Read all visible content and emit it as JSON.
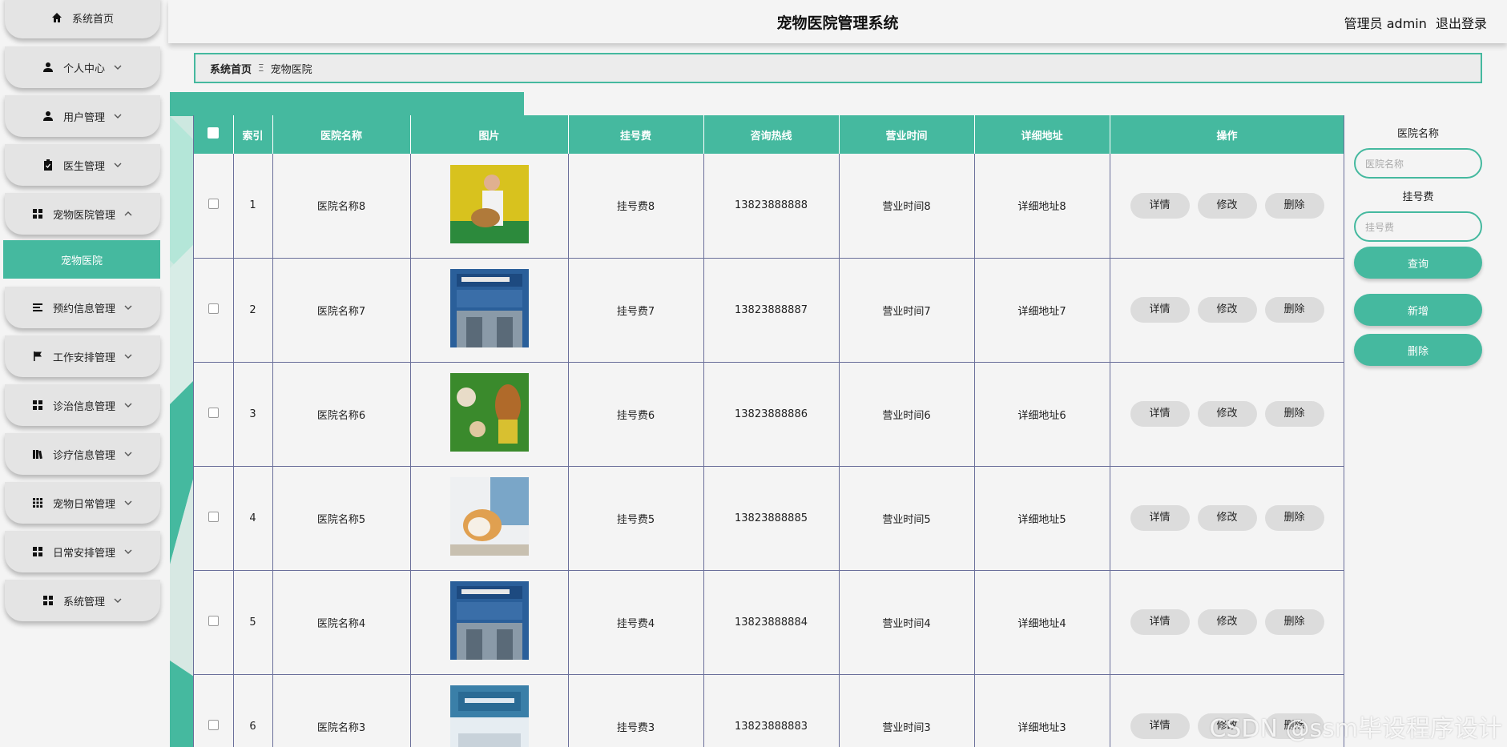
{
  "header": {
    "title": "宠物医院管理系统",
    "user": "管理员 admin",
    "logout": "退出登录"
  },
  "sidebar": {
    "items": [
      {
        "label": "系统首页",
        "icon": "home-icon"
      },
      {
        "label": "个人中心",
        "icon": "person-icon"
      },
      {
        "label": "用户管理",
        "icon": "person-icon"
      },
      {
        "label": "医生管理",
        "icon": "clipboard-icon"
      },
      {
        "label": "宠物医院管理",
        "icon": "grid-icon"
      },
      {
        "label": "预约信息管理",
        "icon": "list-icon"
      },
      {
        "label": "工作安排管理",
        "icon": "flag-icon"
      },
      {
        "label": "诊治信息管理",
        "icon": "grid-icon"
      },
      {
        "label": "诊疗信息管理",
        "icon": "book-icon"
      },
      {
        "label": "宠物日常管理",
        "icon": "apps-icon"
      },
      {
        "label": "日常安排管理",
        "icon": "grid-icon"
      },
      {
        "label": "系统管理",
        "icon": "grid-icon"
      }
    ],
    "active_sub": "宠物医院"
  },
  "breadcrumb": {
    "home": "系统首页",
    "current": "宠物医院"
  },
  "table": {
    "headers": [
      "索引",
      "医院名称",
      "图片",
      "挂号费",
      "咨询热线",
      "营业时间",
      "详细地址",
      "操作"
    ],
    "actions": [
      "详情",
      "修改",
      "删除"
    ],
    "rows": [
      {
        "index": "1",
        "name": "医院名称8",
        "fee": "挂号费8",
        "phone": "13823888888",
        "hours": "营业时间8",
        "address": "详细地址8"
      },
      {
        "index": "2",
        "name": "医院名称7",
        "fee": "挂号费7",
        "phone": "13823888887",
        "hours": "营业时间7",
        "address": "详细地址7"
      },
      {
        "index": "3",
        "name": "医院名称6",
        "fee": "挂号费6",
        "phone": "13823888886",
        "hours": "营业时间6",
        "address": "详细地址6"
      },
      {
        "index": "4",
        "name": "医院名称5",
        "fee": "挂号费5",
        "phone": "13823888885",
        "hours": "营业时间5",
        "address": "详细地址5"
      },
      {
        "index": "5",
        "name": "医院名称4",
        "fee": "挂号费4",
        "phone": "13823888884",
        "hours": "营业时间4",
        "address": "详细地址4"
      },
      {
        "index": "6",
        "name": "医院名称3",
        "fee": "挂号费3",
        "phone": "13823888883",
        "hours": "营业时间3",
        "address": "详细地址3"
      }
    ]
  },
  "search": {
    "name_label": "医院名称",
    "name_placeholder": "医院名称",
    "fee_label": "挂号费",
    "fee_placeholder": "挂号费",
    "query": "查询",
    "add": "新增",
    "delete": "删除"
  },
  "watermark": "CSDN @ssm毕设程序设计",
  "colors": {
    "accent": "#45b99f",
    "border": "#6a6f9a"
  }
}
